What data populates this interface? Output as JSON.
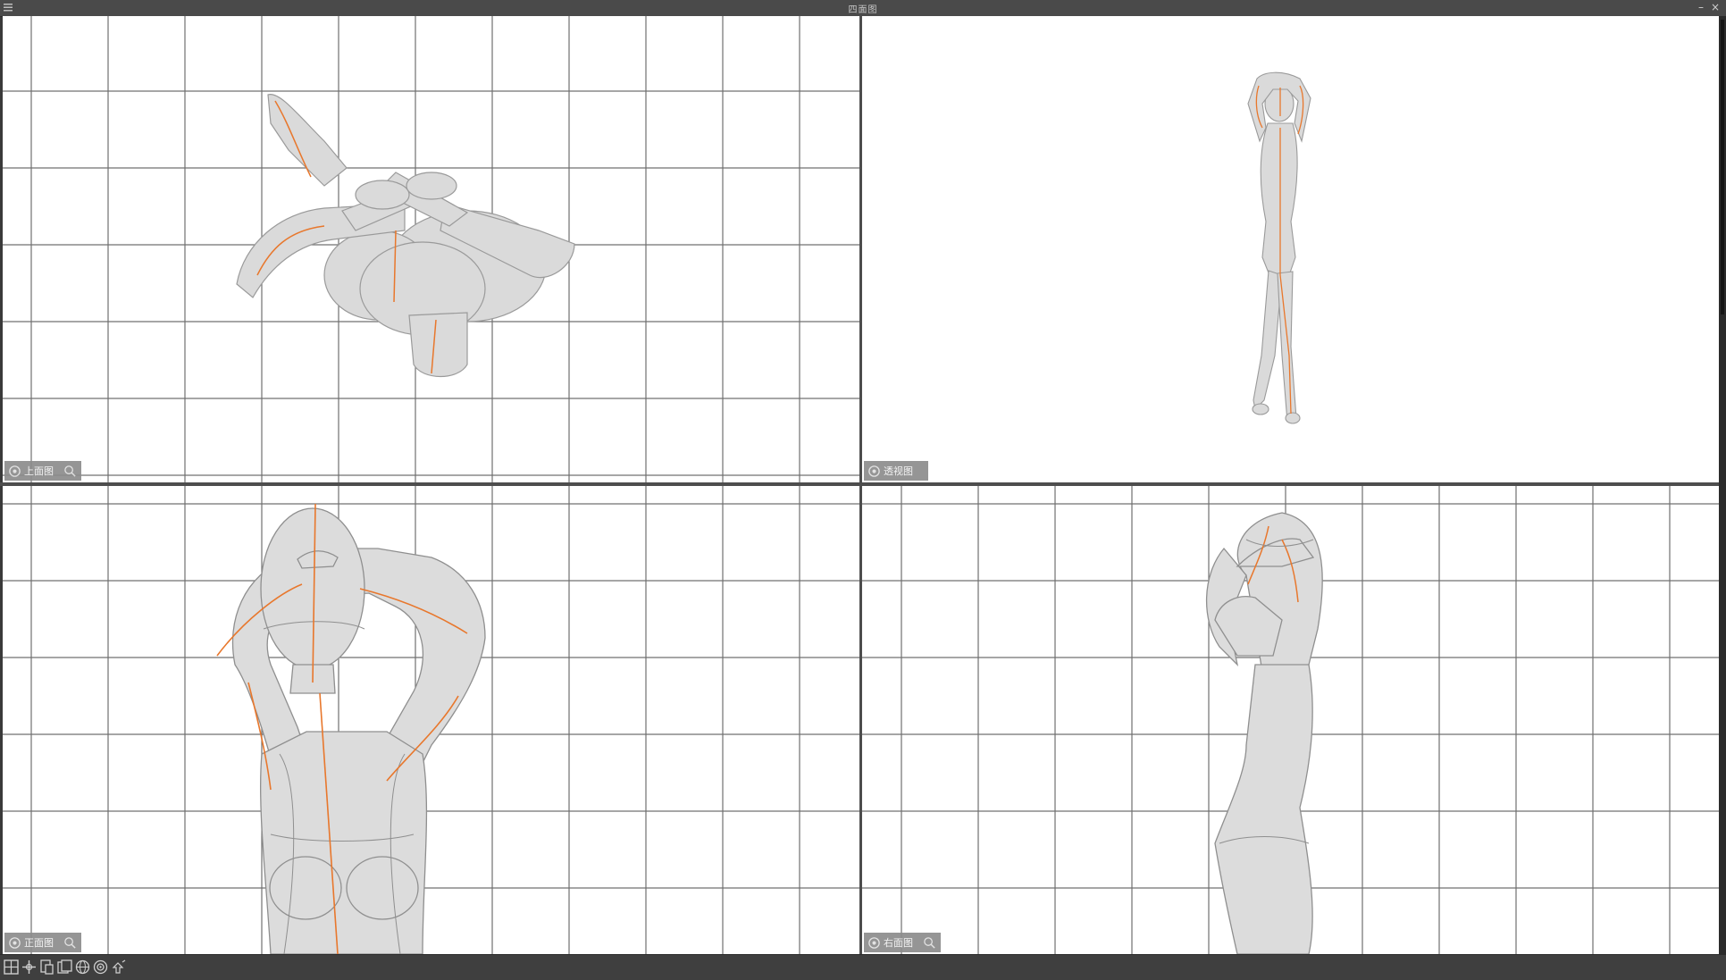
{
  "window": {
    "title": "四面图",
    "buttons": {
      "minimize": "–",
      "close": "×"
    }
  },
  "viewports": {
    "top": {
      "label": "上面图",
      "icon": "camera-icon"
    },
    "perspective": {
      "label": "透视图",
      "icon": "camera-icon"
    },
    "front": {
      "label": "正面图",
      "icon": "camera-icon"
    },
    "right": {
      "label": "右面图",
      "icon": "camera-icon"
    }
  },
  "toolbar": {
    "icons": [
      "layout-four-icon",
      "move-icon",
      "split-view-icon",
      "copy-view-icon",
      "sphere-icon",
      "target-icon",
      "pin-icon"
    ]
  },
  "colors": {
    "grid_line": "#6e6e6e",
    "guide_line": "#e8772c",
    "model_fill": "#d9d9d9",
    "panel_bg": "#ffffff",
    "chrome_bg": "#3a3a3a"
  }
}
